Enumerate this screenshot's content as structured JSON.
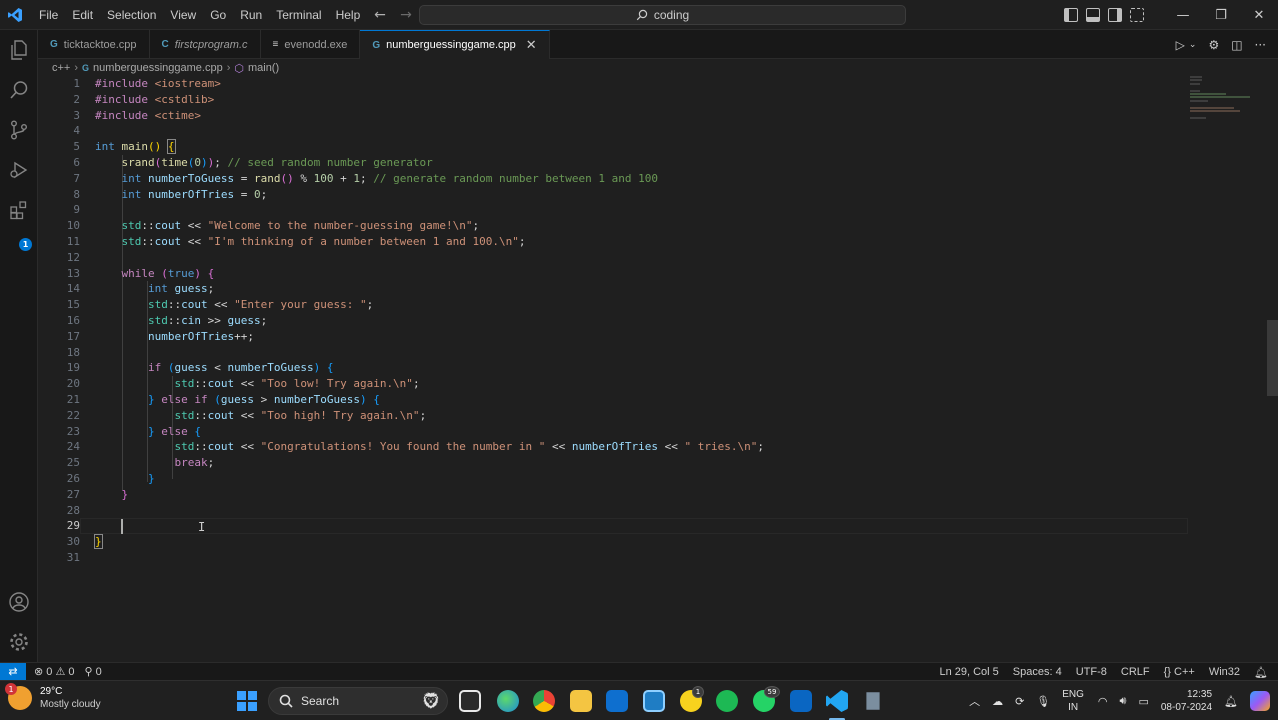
{
  "menu": [
    "File",
    "Edit",
    "Selection",
    "View",
    "Go",
    "Run",
    "Terminal",
    "Help"
  ],
  "command_center": "coding",
  "tabs": [
    {
      "label": "ticktacktoe.cpp",
      "icon": "C++",
      "color": "#519aba",
      "italic": false
    },
    {
      "label": "firstcprogram.c",
      "icon": "C",
      "color": "#519aba",
      "italic": true
    },
    {
      "label": "evenodd.exe",
      "icon": "≡",
      "color": "#cccccc",
      "italic": false
    },
    {
      "label": "numberguessinggame.cpp",
      "icon": "C++",
      "color": "#519aba",
      "italic": false,
      "active": true
    }
  ],
  "breadcrumb": {
    "folder": "c++",
    "file": "numberguessinggame.cpp",
    "symbol": "main()"
  },
  "line_numbers": [
    "1",
    "2",
    "3",
    "4",
    "5",
    "6",
    "7",
    "8",
    "9",
    "10",
    "11",
    "12",
    "13",
    "14",
    "15",
    "16",
    "17",
    "18",
    "19",
    "20",
    "21",
    "22",
    "23",
    "24",
    "25",
    "26",
    "27",
    "28",
    "29",
    "30",
    "31"
  ],
  "current_line": "29",
  "statusbar": {
    "errors": "0",
    "warnings": "0",
    "ports": "0",
    "position": "Ln 29, Col 5",
    "spaces": "Spaces: 4",
    "encoding": "UTF-8",
    "eol": "CRLF",
    "language": "C++",
    "platform": "Win32"
  },
  "taskbar": {
    "temperature": "29°C",
    "weather": "Mostly cloudy",
    "weather_badge": "1",
    "search_label": "Search",
    "whatsapp_badge": "59",
    "app_badge": "1",
    "lang_1": "ENG",
    "lang_2": "IN",
    "time": "12:35",
    "date": "08-07-2024"
  },
  "colors": {
    "accent": "#0078d4",
    "editor_bg": "#1f1f1f"
  }
}
